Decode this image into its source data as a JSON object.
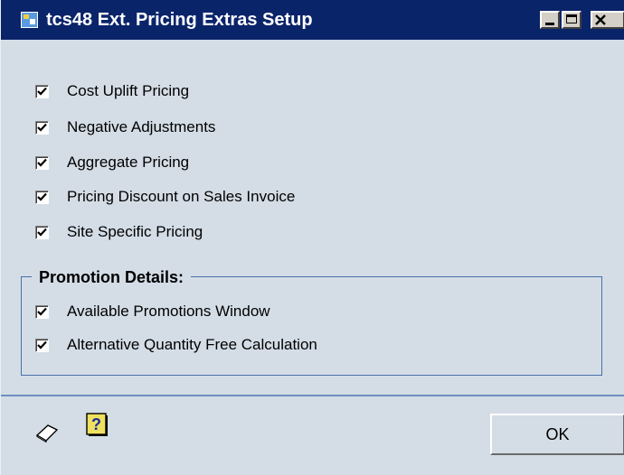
{
  "window": {
    "title": "tcs48 Ext. Pricing Extras Setup"
  },
  "options": [
    {
      "label": "Cost Uplift Pricing",
      "checked": true
    },
    {
      "label": "Negative Adjustments",
      "checked": true
    },
    {
      "label": "Aggregate Pricing",
      "checked": true
    },
    {
      "label": "Pricing Discount on Sales Invoice",
      "checked": true
    },
    {
      "label": "Site Specific Pricing",
      "checked": true
    }
  ],
  "promotion": {
    "title": "Promotion Details:",
    "options": [
      {
        "label": "Available Promotions Window",
        "checked": true
      },
      {
        "label": "Alternative Quantity Free Calculation",
        "checked": true
      }
    ]
  },
  "footer": {
    "ok_label": "OK",
    "note_icon": "note-icon",
    "help_icon": "help-icon",
    "help_glyph": "?"
  },
  "colors": {
    "titlebar": "#0a246a",
    "window_bg": "#d4dde6",
    "group_border": "#4a6fa8"
  }
}
